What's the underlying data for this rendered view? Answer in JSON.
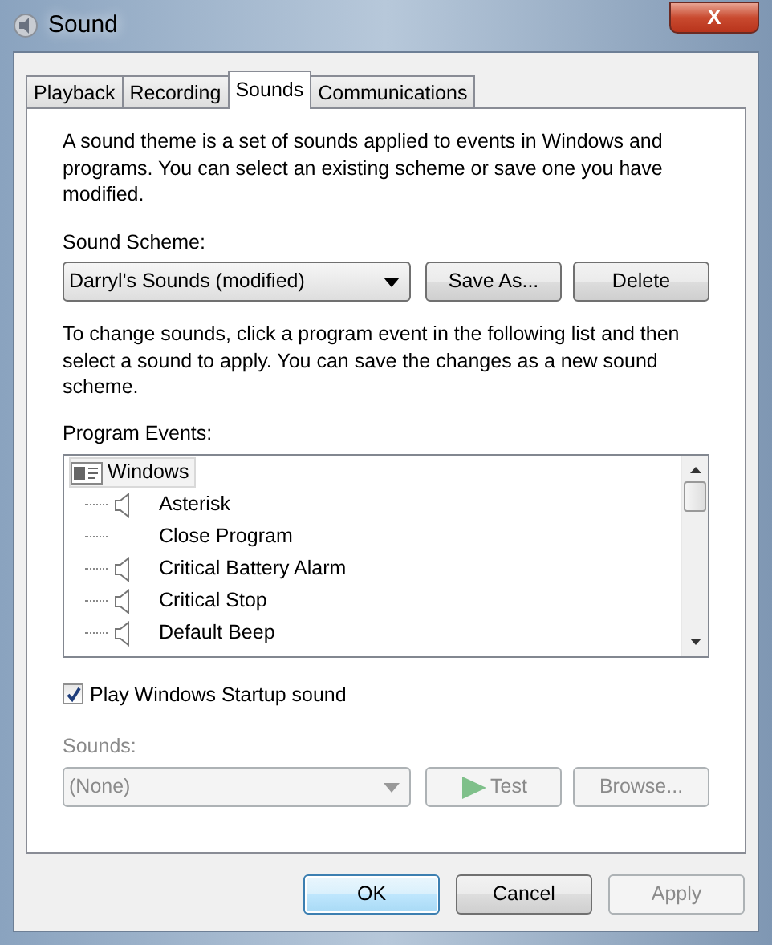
{
  "window": {
    "title": "Sound",
    "close_label": "X"
  },
  "tabs": [
    {
      "label": "Playback",
      "selected": false
    },
    {
      "label": "Recording",
      "selected": false
    },
    {
      "label": "Sounds",
      "selected": true
    },
    {
      "label": "Communications",
      "selected": false
    }
  ],
  "description": "A sound theme is a set of sounds applied to events in Windows and programs. You can select an existing scheme or save one you have modified.",
  "scheme": {
    "label": "Sound Scheme:",
    "value": "Darryl's Sounds (modified)",
    "buttons": [
      {
        "label": "Save As...",
        "disabled": false
      },
      {
        "label": "Delete",
        "disabled": false
      }
    ]
  },
  "instructions": "To change sounds, click a program event in the following list and then select a sound to apply.  You can save the changes as a new sound scheme.",
  "program_events": {
    "label": "Program Events:",
    "tree": [
      {
        "label": "Windows",
        "kind": "group",
        "children": [
          {
            "label": "Asterisk",
            "kind": "event",
            "has_sound": true
          },
          {
            "label": "Close Program",
            "kind": "event",
            "has_sound": false
          },
          {
            "label": "Critical Battery Alarm",
            "kind": "event",
            "has_sound": true
          },
          {
            "label": "Critical Stop",
            "kind": "event",
            "has_sound": true
          },
          {
            "label": "Default Beep",
            "kind": "event",
            "has_sound": true
          }
        ]
      }
    ]
  },
  "startup_sound": {
    "label": "Play Windows Startup sound",
    "checked": true
  },
  "sounds": {
    "label": "Sounds:",
    "value": "(None)",
    "disabled": true,
    "buttons": [
      {
        "label": "Test",
        "kind": "play",
        "disabled": true
      },
      {
        "label": "Browse...",
        "kind": "plain",
        "disabled": true
      }
    ]
  },
  "dialog_buttons": [
    {
      "label": "OK",
      "default": true,
      "disabled": false
    },
    {
      "label": "Cancel",
      "default": false,
      "disabled": false
    },
    {
      "label": "Apply",
      "default": false,
      "disabled": true
    }
  ]
}
